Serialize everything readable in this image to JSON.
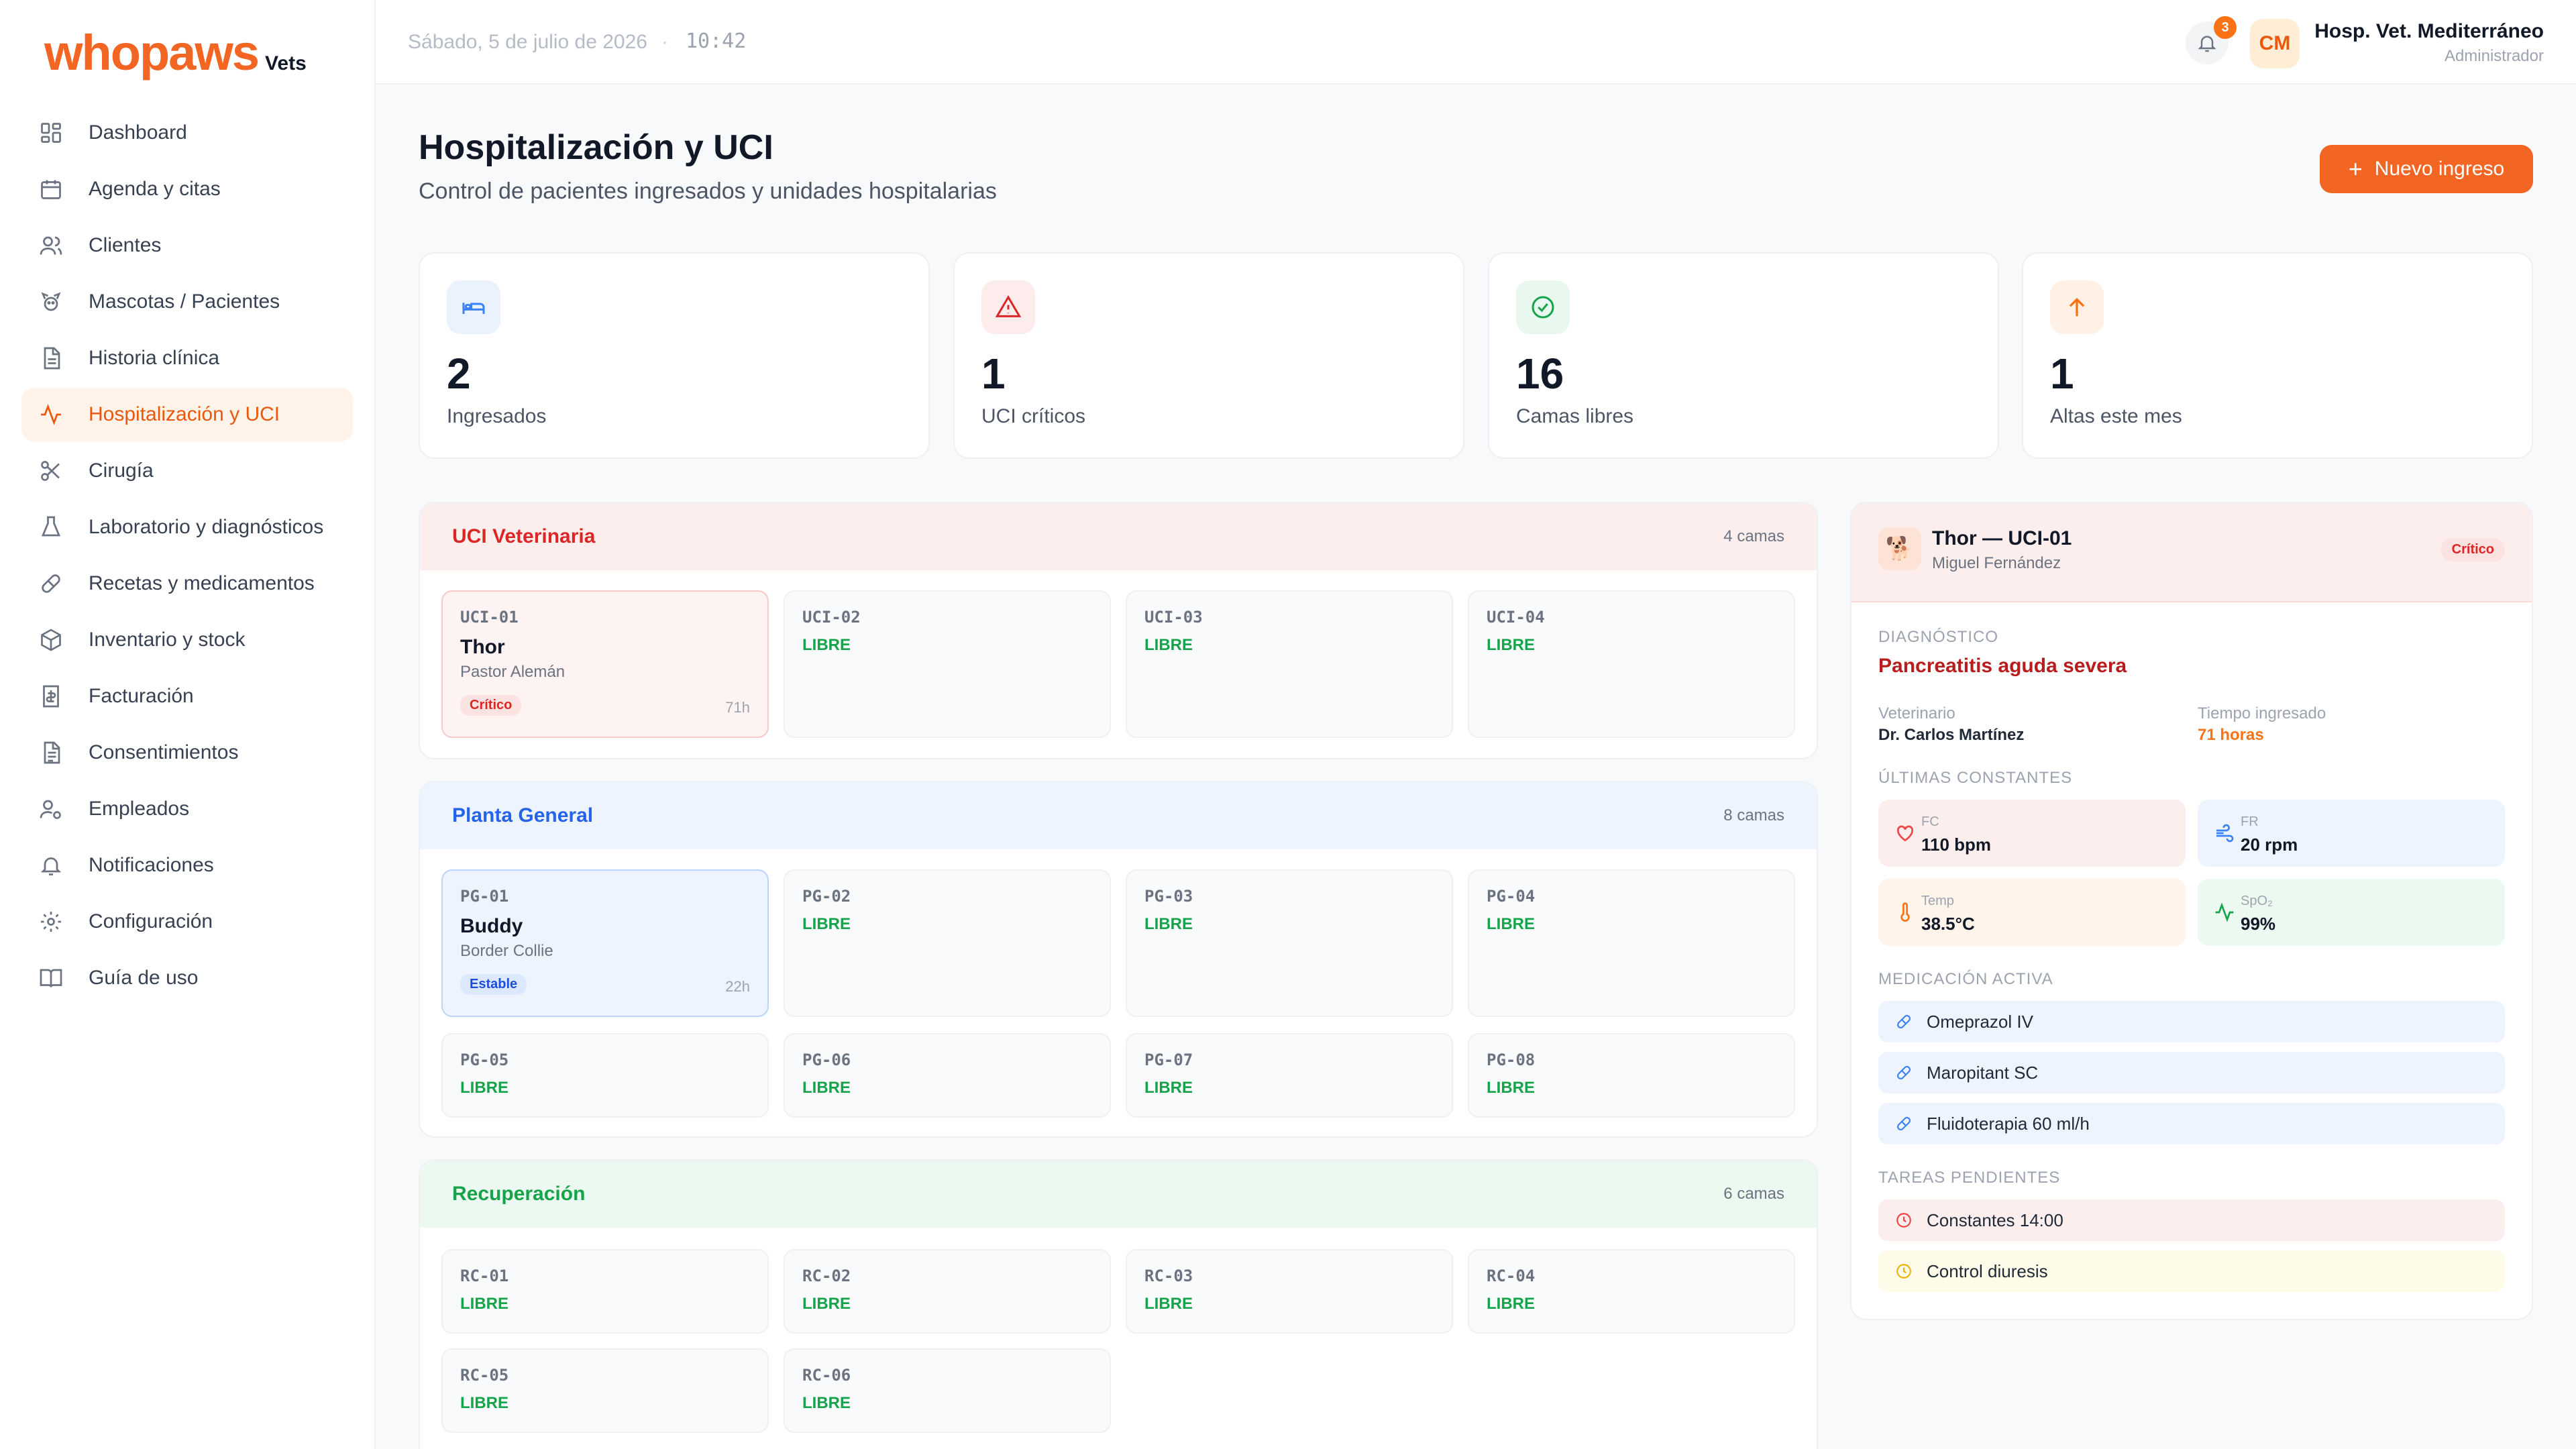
{
  "brand": {
    "name": "whopaws",
    "suffix": "Vets"
  },
  "sidebar": {
    "items": [
      {
        "label": "Dashboard",
        "icon": "grid-icon"
      },
      {
        "label": "Agenda y citas",
        "icon": "calendar-icon"
      },
      {
        "label": "Clientes",
        "icon": "users-icon"
      },
      {
        "label": "Mascotas / Pacientes",
        "icon": "paw-icon"
      },
      {
        "label": "Historia clínica",
        "icon": "document-icon"
      },
      {
        "label": "Hospitalización y UCI",
        "icon": "activity-icon",
        "active": true
      },
      {
        "label": "Cirugía",
        "icon": "scissors-icon"
      },
      {
        "label": "Laboratorio y diagnósticos",
        "icon": "flask-icon"
      },
      {
        "label": "Recetas y medicamentos",
        "icon": "pill-icon"
      },
      {
        "label": "Inventario y stock",
        "icon": "box-icon"
      },
      {
        "label": "Facturación",
        "icon": "invoice-icon"
      },
      {
        "label": "Consentimientos",
        "icon": "file-text-icon"
      },
      {
        "label": "Empleados",
        "icon": "user-gear-icon"
      },
      {
        "label": "Notificaciones",
        "icon": "bell-icon"
      },
      {
        "label": "Configuración",
        "icon": "gear-icon"
      },
      {
        "label": "Guía de uso",
        "icon": "book-icon"
      }
    ]
  },
  "topbar": {
    "date": "Sábado, 5 de julio de 2026",
    "separator": "·",
    "time": "10:42",
    "notifications_count": "3",
    "avatar_initials": "CM",
    "user_name": "Hosp. Vet. Mediterráneo",
    "user_role": "Administrador"
  },
  "page": {
    "title": "Hospitalización y UCI",
    "subtitle": "Control de pacientes ingresados y unidades hospitalarias",
    "new_button": "Nuevo ingreso",
    "new_button_icon": "+"
  },
  "stats": [
    {
      "value": "2",
      "label": "Ingresados",
      "icon": "bed-icon",
      "color": "#3b82f6"
    },
    {
      "value": "1",
      "label": "UCI críticos",
      "icon": "alert-triangle-icon",
      "color": "#dc2626"
    },
    {
      "value": "16",
      "label": "Camas libres",
      "icon": "check-circle-icon",
      "color": "#16a34a"
    },
    {
      "value": "1",
      "label": "Altas este mes",
      "icon": "arrow-up-icon",
      "color": "#f97316"
    }
  ],
  "units": {
    "uci": {
      "name": "UCI Veterinaria",
      "count": "4 camas",
      "color": "#dc2626",
      "beds": [
        {
          "code": "UCI-01",
          "pet": "Thor",
          "breed": "Pastor Alemán",
          "status": "Crítico",
          "hours": "71h"
        },
        {
          "code": "UCI-02",
          "free": "LIBRE"
        },
        {
          "code": "UCI-03",
          "free": "LIBRE"
        },
        {
          "code": "UCI-04",
          "free": "LIBRE"
        }
      ]
    },
    "pg": {
      "name": "Planta General",
      "count": "8 camas",
      "color": "#2563eb",
      "beds": [
        {
          "code": "PG-01",
          "pet": "Buddy",
          "breed": "Border Collie",
          "status": "Estable",
          "hours": "22h"
        },
        {
          "code": "PG-02",
          "free": "LIBRE"
        },
        {
          "code": "PG-03",
          "free": "LIBRE"
        },
        {
          "code": "PG-04",
          "free": "LIBRE"
        },
        {
          "code": "PG-05",
          "free": "LIBRE"
        },
        {
          "code": "PG-06",
          "free": "LIBRE"
        },
        {
          "code": "PG-07",
          "free": "LIBRE"
        },
        {
          "code": "PG-08",
          "free": "LIBRE"
        }
      ]
    },
    "rc": {
      "name": "Recuperación",
      "count": "6 camas",
      "color": "#16a34a",
      "beds": [
        {
          "code": "RC-01",
          "free": "LIBRE"
        },
        {
          "code": "RC-02",
          "free": "LIBRE"
        },
        {
          "code": "RC-03",
          "free": "LIBRE"
        },
        {
          "code": "RC-04",
          "free": "LIBRE"
        },
        {
          "code": "RC-05",
          "free": "LIBRE"
        },
        {
          "code": "RC-06",
          "free": "LIBRE"
        }
      ]
    }
  },
  "detail": {
    "pet_emoji": "🐕",
    "title": "Thor — UCI-01",
    "owner": "Miguel Fernández",
    "badge": "Crítico",
    "diagnosis_label": "DIAGNÓSTICO",
    "diagnosis": "Pancreatitis aguda severa",
    "vet_label": "Veterinario",
    "vet": "Dr. Carlos Martínez",
    "time_label": "Tiempo ingresado",
    "time": "71 horas",
    "vitals_label": "ÚLTIMAS CONSTANTES",
    "vitals": [
      {
        "label": "FC",
        "value": "110 bpm",
        "icon": "heart-icon"
      },
      {
        "label": "FR",
        "value": "20 rpm",
        "icon": "wind-icon"
      },
      {
        "label": "Temp",
        "value": "38.5°C",
        "icon": "thermometer-icon"
      },
      {
        "label": "SpO₂",
        "value": "99%",
        "icon": "pulse-icon"
      }
    ],
    "meds_label": "MEDICACIÓN ACTIVA",
    "meds": [
      "Omeprazol IV",
      "Maropitant SC",
      "Fluidoterapia 60 ml/h"
    ],
    "tasks_label": "TAREAS PENDIENTES",
    "tasks": [
      "Constantes 14:00",
      "Control diuresis"
    ]
  }
}
